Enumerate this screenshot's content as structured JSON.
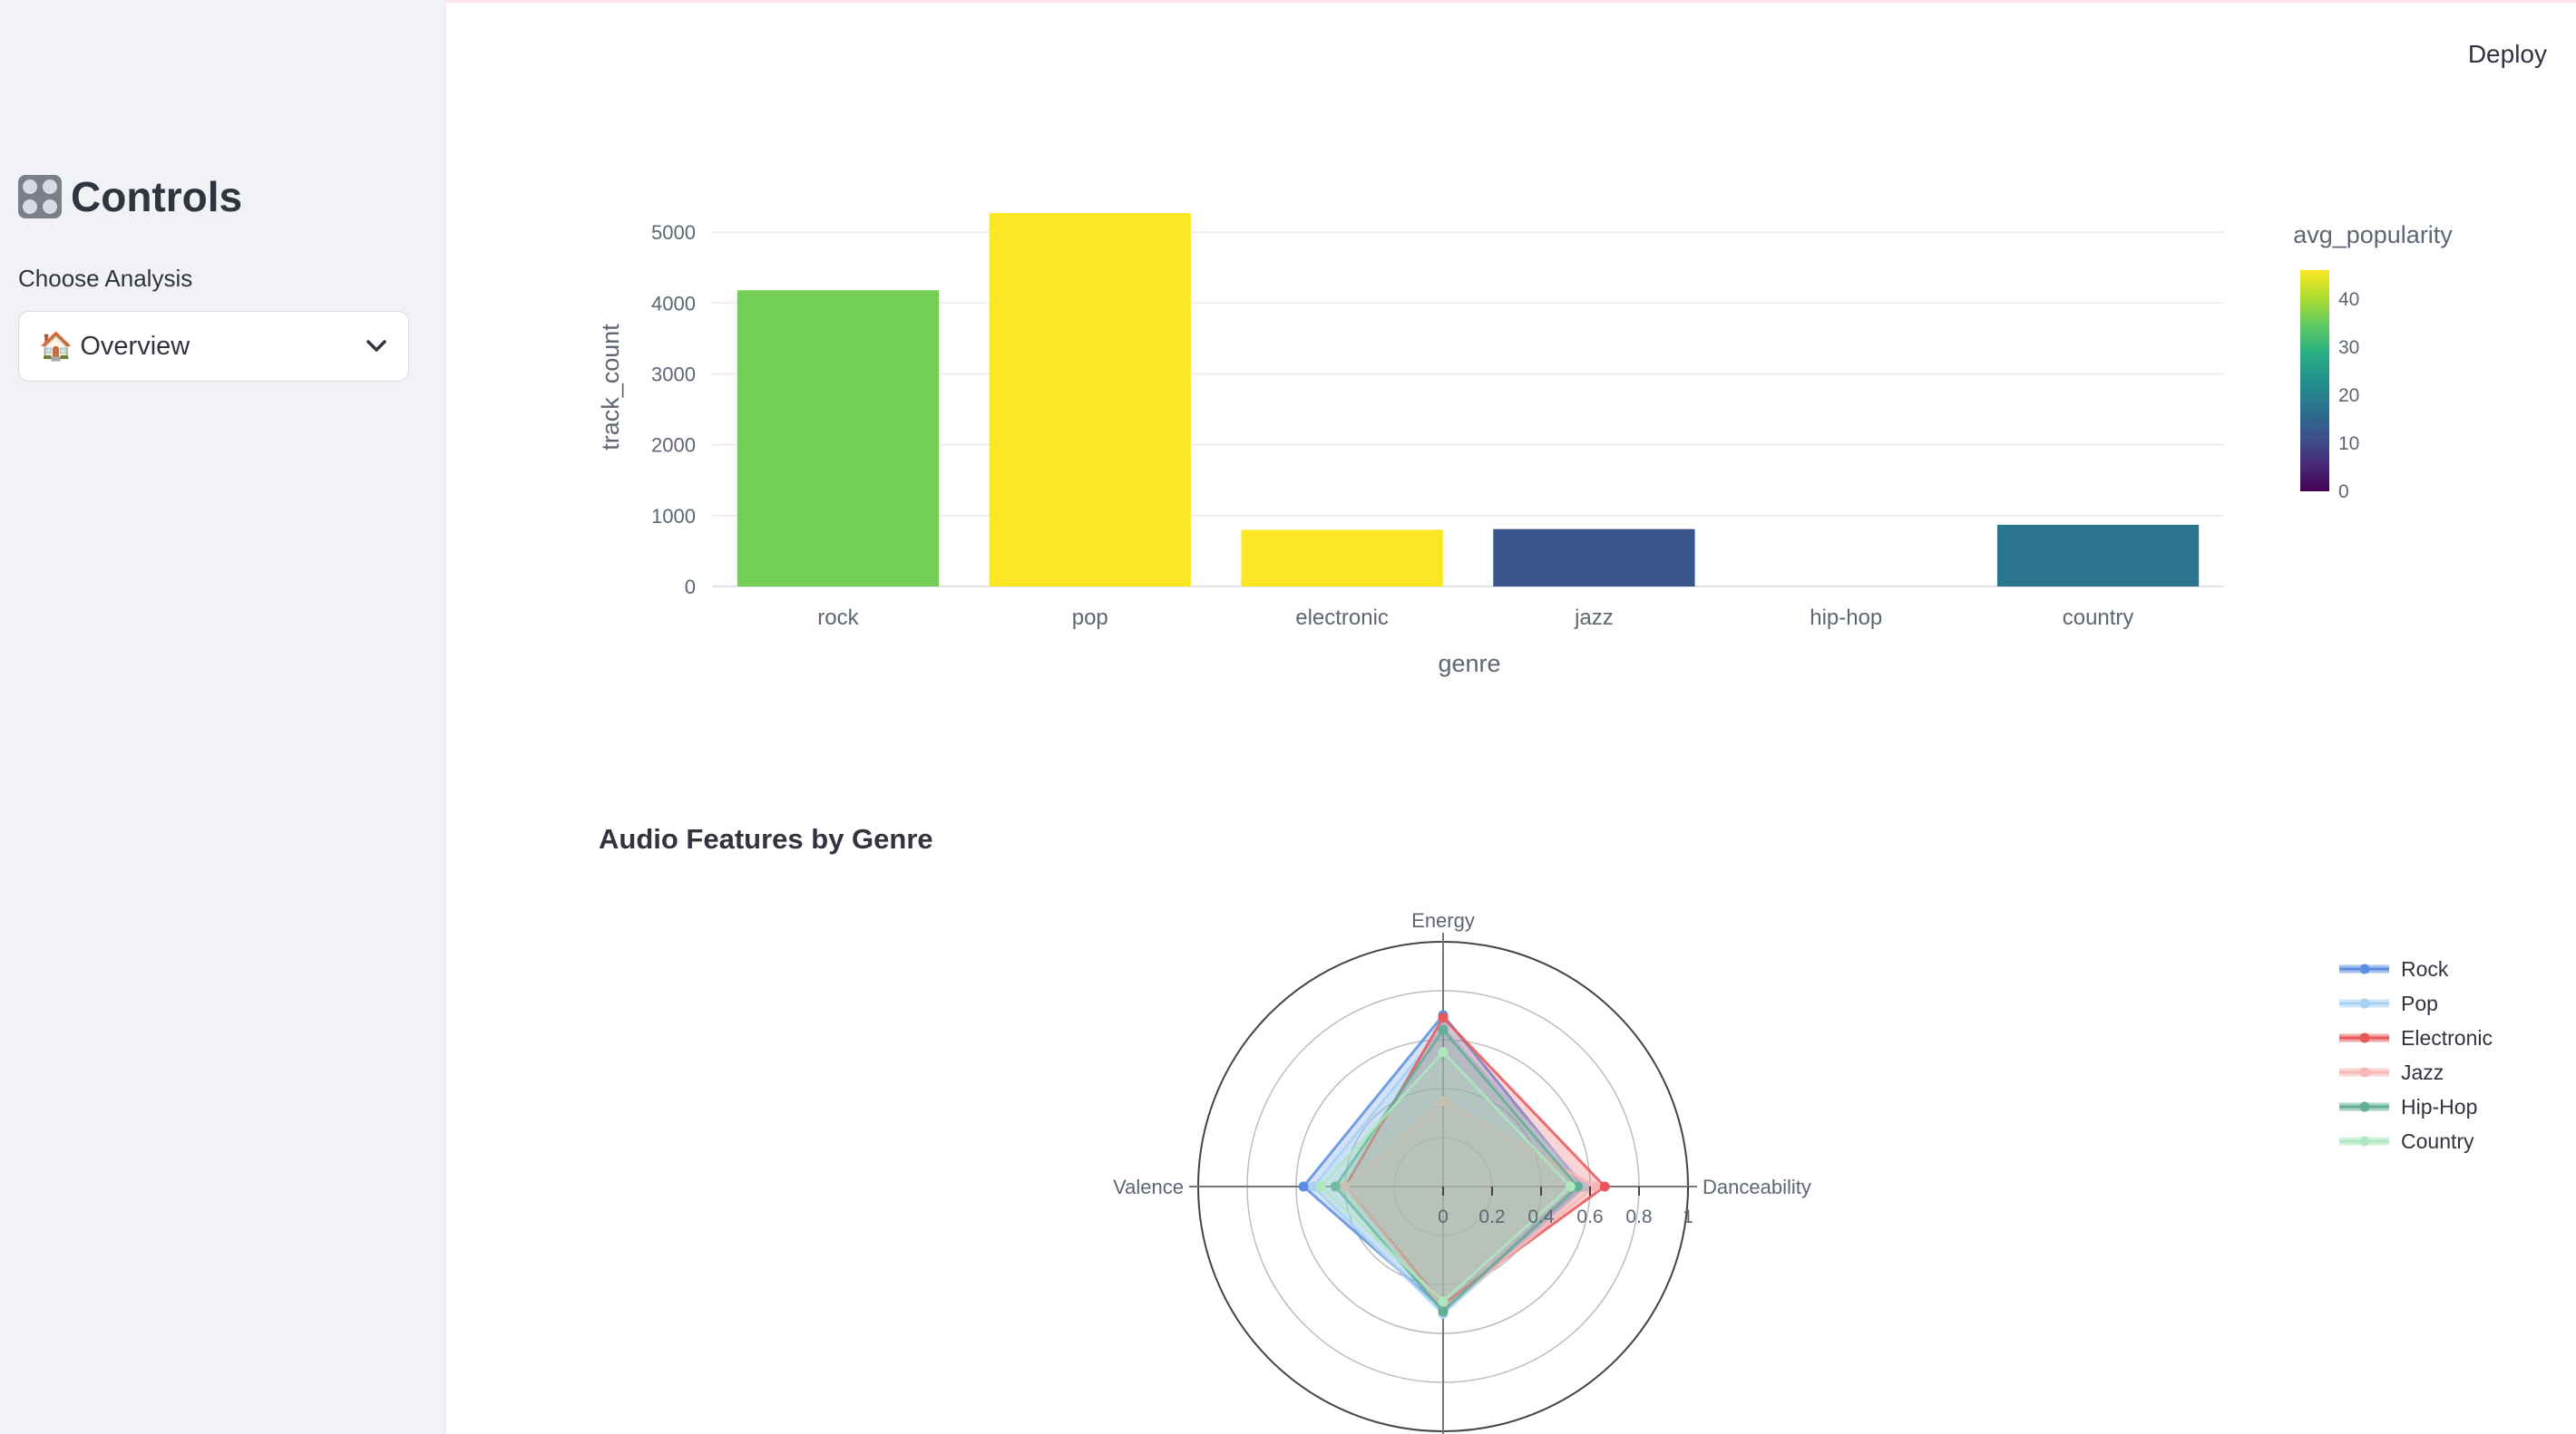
{
  "header": {
    "deploy_label": "Deploy"
  },
  "sidebar": {
    "title": "Controls",
    "title_icon": "control-knobs-icon",
    "select_label": "Choose Analysis",
    "select_value": "Overview",
    "select_icon": "house-icon"
  },
  "main": {
    "section_title": "Audio Features by Genre"
  },
  "colors": {
    "sidebar_bg": "#f0f2f6",
    "accent_line": "#fde7ea"
  },
  "chart_data": [
    {
      "type": "bar",
      "xlabel": "genre",
      "ylabel": "track_count",
      "categories": [
        "rock",
        "pop",
        "electronic",
        "jazz",
        "hip-hop",
        "country"
      ],
      "values": [
        4180,
        5270,
        800,
        810,
        0,
        870
      ],
      "color_values": [
        36,
        46,
        46,
        12,
        0,
        18
      ],
      "colorbar": {
        "title": "avg_popularity",
        "ticks": [
          0,
          10,
          20,
          30,
          40
        ],
        "range": [
          0,
          46
        ],
        "colorscale": "viridis"
      },
      "yticks": [
        0,
        1000,
        2000,
        3000,
        4000,
        5000
      ],
      "ylim": [
        0,
        5500
      ],
      "grid": true
    },
    {
      "type": "radar",
      "axes": [
        "Energy",
        "Danceability",
        "Valence"
      ],
      "radial_ticks": [
        "0",
        "0.2",
        "0.4",
        "0.6",
        "0.8",
        "1"
      ],
      "radial_range": [
        0,
        1
      ],
      "legend_position": "right",
      "series": [
        {
          "name": "Rock",
          "color": "#5b8fdf",
          "opacity": 0.45,
          "values": {
            "Energy": 0.7,
            "Danceability": 0.57,
            "Valence": 0.57,
            "Down": 0.5
          }
        },
        {
          "name": "Pop",
          "color": "#a8d1f2",
          "opacity": 0.45,
          "values": {
            "Energy": 0.65,
            "Danceability": 0.58,
            "Valence": 0.53,
            "Down": 0.52
          }
        },
        {
          "name": "Electronic",
          "color": "#e8575a",
          "opacity": 0.45,
          "values": {
            "Energy": 0.69,
            "Danceability": 0.66,
            "Valence": 0.4,
            "Down": 0.48
          }
        },
        {
          "name": "Jazz",
          "color": "#f6b7b5",
          "opacity": 0.55,
          "values": {
            "Energy": 0.35,
            "Danceability": 0.62,
            "Valence": 0.4,
            "Down": 0.5
          }
        },
        {
          "name": "Hip-Hop",
          "color": "#5fae95",
          "opacity": 0.45,
          "values": {
            "Energy": 0.64,
            "Danceability": 0.55,
            "Valence": 0.44,
            "Down": 0.51
          }
        },
        {
          "name": "Country",
          "color": "#aee8bf",
          "opacity": 0.45,
          "values": {
            "Energy": 0.55,
            "Danceability": 0.52,
            "Valence": 0.5,
            "Down": 0.47
          }
        }
      ]
    }
  ]
}
